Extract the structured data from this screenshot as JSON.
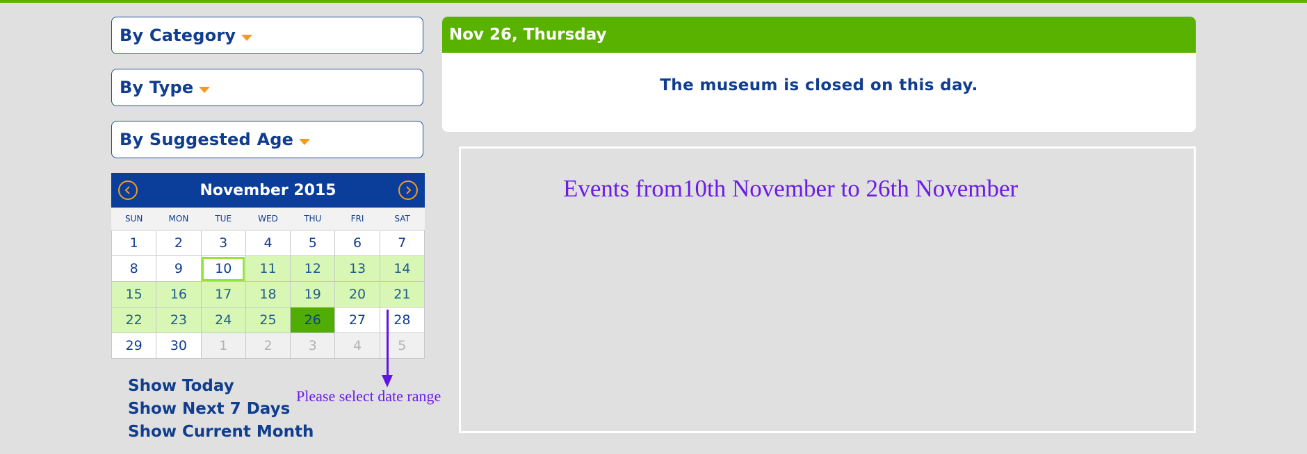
{
  "filters": [
    {
      "label": "By Category"
    },
    {
      "label": "By Type"
    },
    {
      "label": "By Suggested Age"
    }
  ],
  "calendar": {
    "month_label": "November 2015",
    "weekdays": [
      "SUN",
      "MON",
      "TUE",
      "WED",
      "THU",
      "FRI",
      "SAT"
    ],
    "weeks": [
      [
        "1",
        "2",
        "3",
        "4",
        "5",
        "6",
        "7"
      ],
      [
        "8",
        "9",
        "10",
        "11",
        "12",
        "13",
        "14"
      ],
      [
        "15",
        "16",
        "17",
        "18",
        "19",
        "20",
        "21"
      ],
      [
        "22",
        "23",
        "24",
        "25",
        "26",
        "27",
        "28"
      ],
      [
        "29",
        "30",
        "1",
        "2",
        "3",
        "4",
        "5"
      ]
    ],
    "range_start": "10",
    "range_end": "26"
  },
  "quick_links": {
    "today": "Show Today",
    "next7": "Show Next 7 Days",
    "month": "Show Current Month"
  },
  "annotation": {
    "note": "Please select date range",
    "events_title": "Events from10th November to 26th November"
  },
  "day_panel": {
    "heading": "Nov 26, Thursday",
    "message": "The museum is closed on this day."
  },
  "colors": {
    "brand_green": "#5ab200",
    "brand_blue": "#0a3e9a",
    "accent_orange": "#f29b1d",
    "annotation_purple": "#6b1ce6"
  },
  "icons": {
    "prev": "chevron-left-circle-icon",
    "next": "chevron-right-circle-icon",
    "dropdown": "caret-down-icon"
  }
}
